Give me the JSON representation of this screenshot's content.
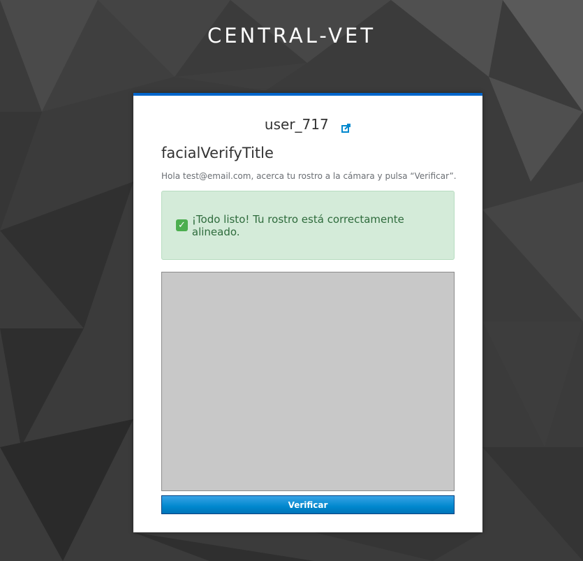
{
  "app": {
    "brand": "CENTRAL-VET"
  },
  "header": {
    "username": "user_717",
    "share_icon": "external-link-icon"
  },
  "main": {
    "title": "facialVerifyTitle",
    "instructions": "Hola test@email.com, acerca tu rostro a la cámara y pulsa “Verificar”.",
    "status_message": "¡Todo listo! Tu rostro está correctamente alineado.",
    "status_icon": "check-mark-icon",
    "camera_feed": {
      "face_mesh_detected": true
    },
    "verify_button_label": "Verificar"
  },
  "colors": {
    "accent": "#0066cc",
    "success_bg": "#d4ebd9",
    "success_text": "#2e6b3c",
    "button": "#0088ce",
    "mesh": "#1fbfa8"
  }
}
